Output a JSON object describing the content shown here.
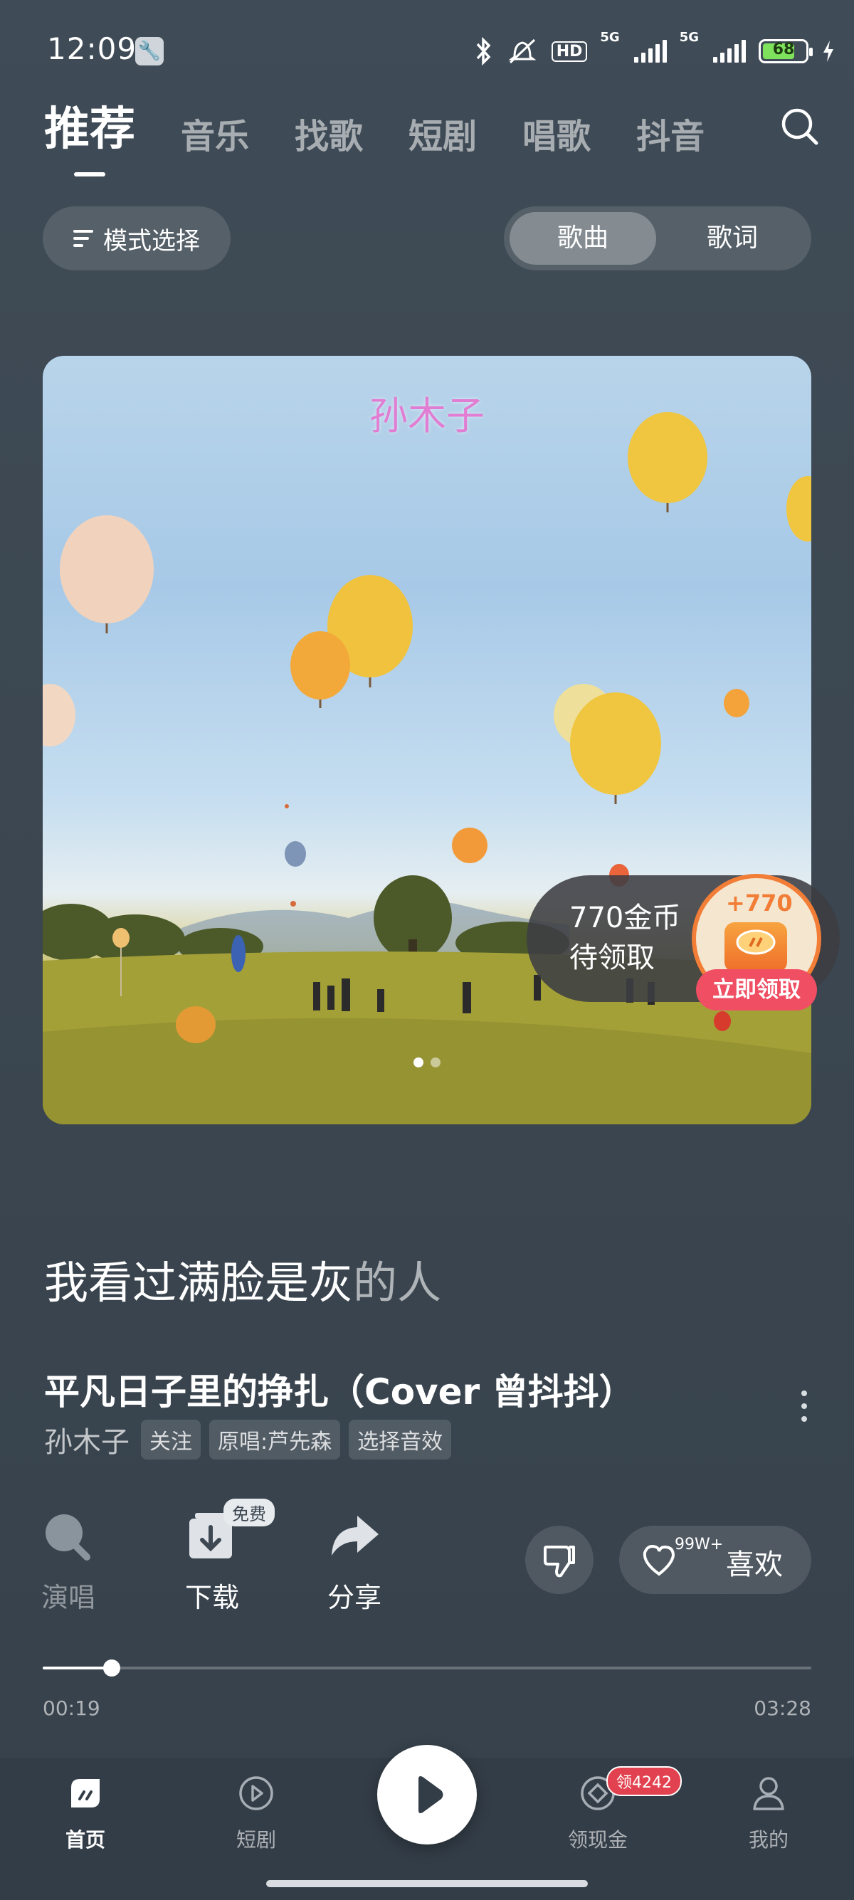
{
  "status_bar": {
    "time": "12:09",
    "network_1": "5G",
    "network_2": "5G",
    "hd_label": "HD",
    "battery_level": "68",
    "icons": [
      "wrench-icon",
      "bluetooth-icon",
      "mute-vibrate-icon",
      "signal-icon",
      "battery-icon",
      "charging-icon"
    ]
  },
  "top_tabs": {
    "items": [
      "推荐",
      "音乐",
      "找歌",
      "短剧",
      "唱歌",
      "抖音"
    ],
    "active_index": 0
  },
  "mode_button": {
    "label": "模式选择"
  },
  "view_toggle": {
    "options": [
      "歌曲",
      "歌词"
    ],
    "selected": "歌曲"
  },
  "cover": {
    "title_text": "孙木子",
    "page_count": 2,
    "active_page": 1
  },
  "coin_popup": {
    "line1": "770金币",
    "line2": "待领取",
    "bonus": "+770",
    "claim_label": "立即领取"
  },
  "lyric": {
    "sung": "我看过满脸是灰",
    "upcoming": "的人"
  },
  "song": {
    "title": "平凡日子里的挣扎（Cover 曾抖抖）",
    "artist": "孙木子",
    "follow_label": "关注",
    "original_label": "原唱:芦先森",
    "effect_label": "选择音效"
  },
  "actions": {
    "sing_label": "演唱",
    "download_label": "下载",
    "free_badge": "免费",
    "share_label": "分享",
    "like_count": "99W+",
    "like_label": "喜欢"
  },
  "playback": {
    "current_time": "00:19",
    "total_time": "03:28",
    "progress": 0.09
  },
  "bottom_nav": {
    "home_label": "首页",
    "drama_label": "短剧",
    "cash_label": "领现金",
    "cash_badge": "领4242",
    "mine_label": "我的",
    "active": "首页"
  },
  "colors": {
    "background": "#3d4853",
    "accent_orange": "#f27d36",
    "claim_red": "#ef4e63",
    "badge_red": "#e2424f"
  }
}
